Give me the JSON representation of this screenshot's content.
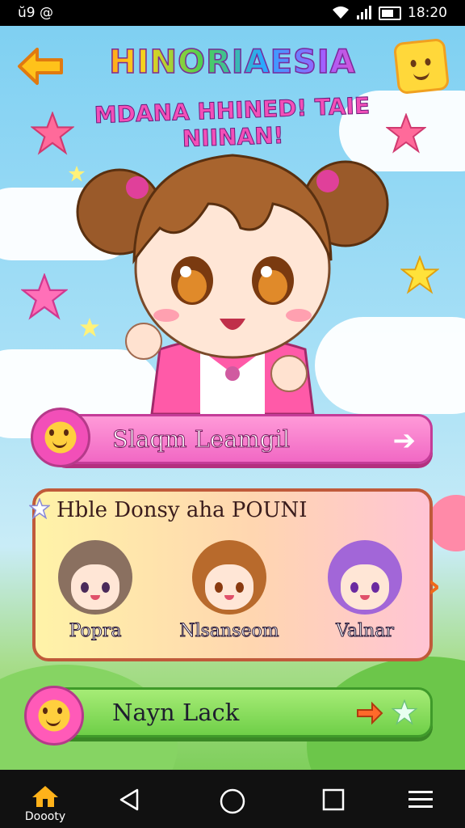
{
  "status_bar": {
    "left_text": "ŭ9 @",
    "time": "18:20"
  },
  "header": {
    "title": "HINORIAESIA",
    "subtitle": "MDANA HHINED! TAIE NIINAN!"
  },
  "buttons": {
    "start_label": "Slaqm Leamgil",
    "lock_label": "Nayn Lack"
  },
  "panel": {
    "title": "Hble Donsy aha POUNI",
    "characters": [
      {
        "name": "Popra",
        "hair_color": "#8a7060",
        "accent": "#7a3ab0"
      },
      {
        "name": "Nlsanseom",
        "hair_color": "#b86a2c",
        "accent": "#e04a6a"
      },
      {
        "name": "Valnar",
        "hair_color": "#a266d8",
        "accent": "#ffffff"
      }
    ]
  },
  "nav": {
    "home_label": "Doooty"
  },
  "colors": {
    "pink_button": "#f168c4",
    "green_button": "#6fcf48",
    "panel_border": "#c05a3a",
    "title_stroke": "#7a2a9a"
  }
}
